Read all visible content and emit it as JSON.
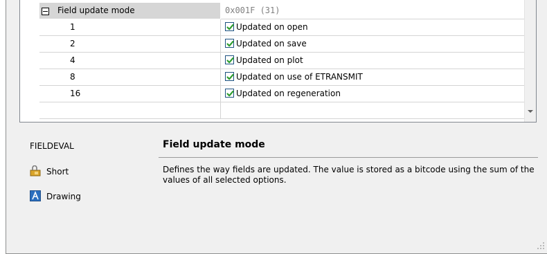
{
  "grid": {
    "header": {
      "name": "Field update mode",
      "value": "0x001F (31)"
    },
    "rows": [
      {
        "value": "1",
        "label": "Updated on open",
        "checked": true
      },
      {
        "value": "2",
        "label": "Updated on save",
        "checked": true
      },
      {
        "value": "4",
        "label": "Updated on plot",
        "checked": true
      },
      {
        "value": "8",
        "label": "Updated on use of ETRANSMIT",
        "checked": true
      },
      {
        "value": "16",
        "label": "Updated on regeneration",
        "checked": true
      }
    ]
  },
  "info": {
    "variable_name": "FIELDEVAL",
    "type_label": "Short",
    "saved_in_label": "Drawing",
    "type_icon": "short-type-icon",
    "saved_in_icon": "drawing-icon",
    "title": "Field update mode",
    "description": "Defines the way fields are updated. The value is stored as a bitcode using the sum of the values of all selected options."
  },
  "colors": {
    "checkbox_border": "#1c5180",
    "check_mark": "#2f9e2f",
    "header_bg": "#d6d6d6"
  }
}
